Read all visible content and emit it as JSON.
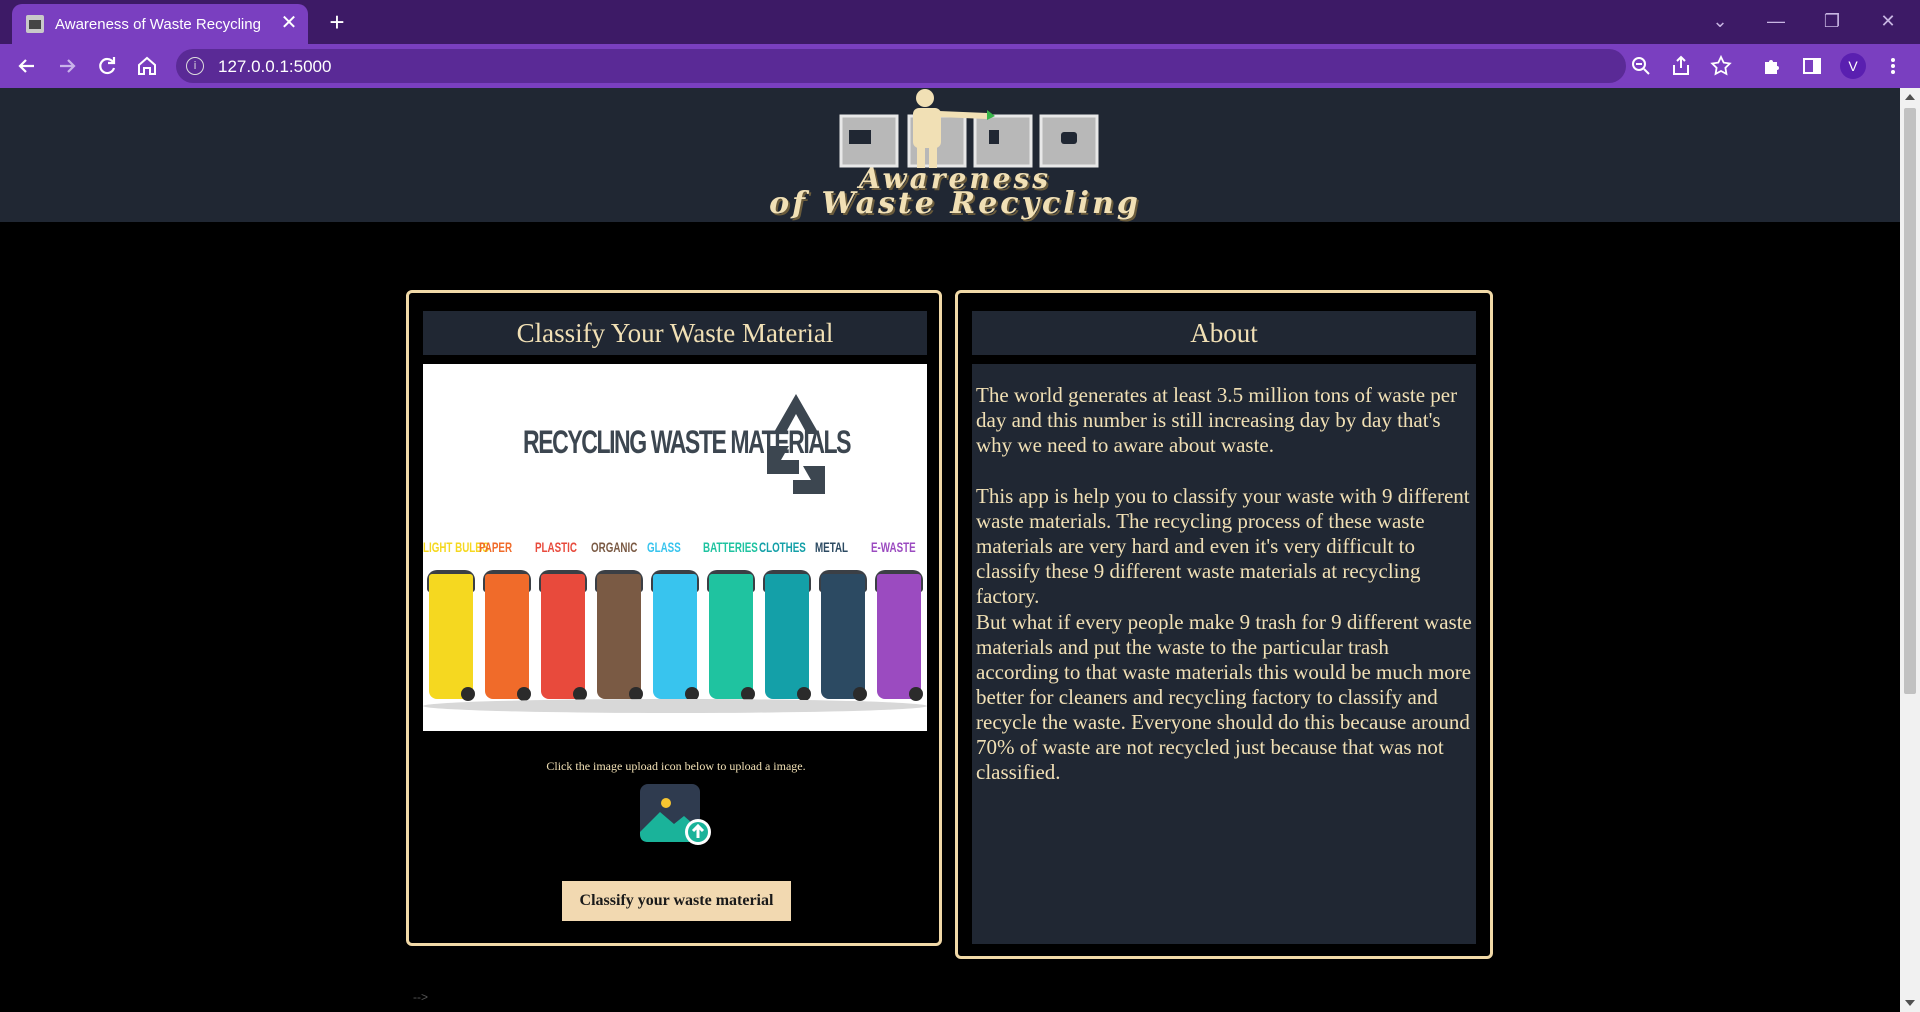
{
  "browser": {
    "tab_title": "Awareness of Waste Recycling",
    "tab_close": "✕",
    "new_tab": "+",
    "url": "127.0.0.1:5000",
    "profile_initial": "V",
    "info_icon": "i"
  },
  "header": {
    "logo_line1": "Awareness",
    "logo_line2": "of Waste Recycling"
  },
  "classify_panel": {
    "title": "Classify Your Waste Material",
    "image_heading": "RECYCLING WASTE MATERIALS",
    "bins": [
      {
        "label": "LIGHT BULBS",
        "color": "#f5d820"
      },
      {
        "label": "PAPER",
        "color": "#f06b2a"
      },
      {
        "label": "PLASTIC",
        "color": "#e84a3c"
      },
      {
        "label": "ORGANIC",
        "color": "#7a5a44"
      },
      {
        "label": "GLASS",
        "color": "#38c4ee"
      },
      {
        "label": "BATTERIES",
        "color": "#1fc3a0"
      },
      {
        "label": "CLOTHES",
        "color": "#14a0a8"
      },
      {
        "label": "METAL",
        "color": "#2c4a62"
      },
      {
        "label": "E-WASTE",
        "color": "#9b4bc0"
      }
    ],
    "hint": "Click the image upload icon below to upload a image.",
    "button_label": "Classify your waste material"
  },
  "about_panel": {
    "title": "About",
    "paragraphs": [
      "The world generates at least 3.5 million tons of waste per day and this number is still increasing day by day that's why we need to aware about waste.",
      "This app is help you to classify your waste with 9 different waste materials. The recycling process of these waste materials are very hard and even it's very difficult to classify these 9 different waste materials at recycling factory.",
      "But what if every people make 9 trash for 9 different waste materials and put the waste to the particular trash according to that waste materials this would be much more better for cleaners and recycling factory to classify and recycle the waste. Everyone should do this because around 70% of waste are not recycled just because that was not classified."
    ]
  },
  "stray_text": "-->",
  "colors": {
    "accent": "#f1d9a7",
    "panel_bg": "#202733",
    "browser_frame": "#7a3fc0"
  }
}
